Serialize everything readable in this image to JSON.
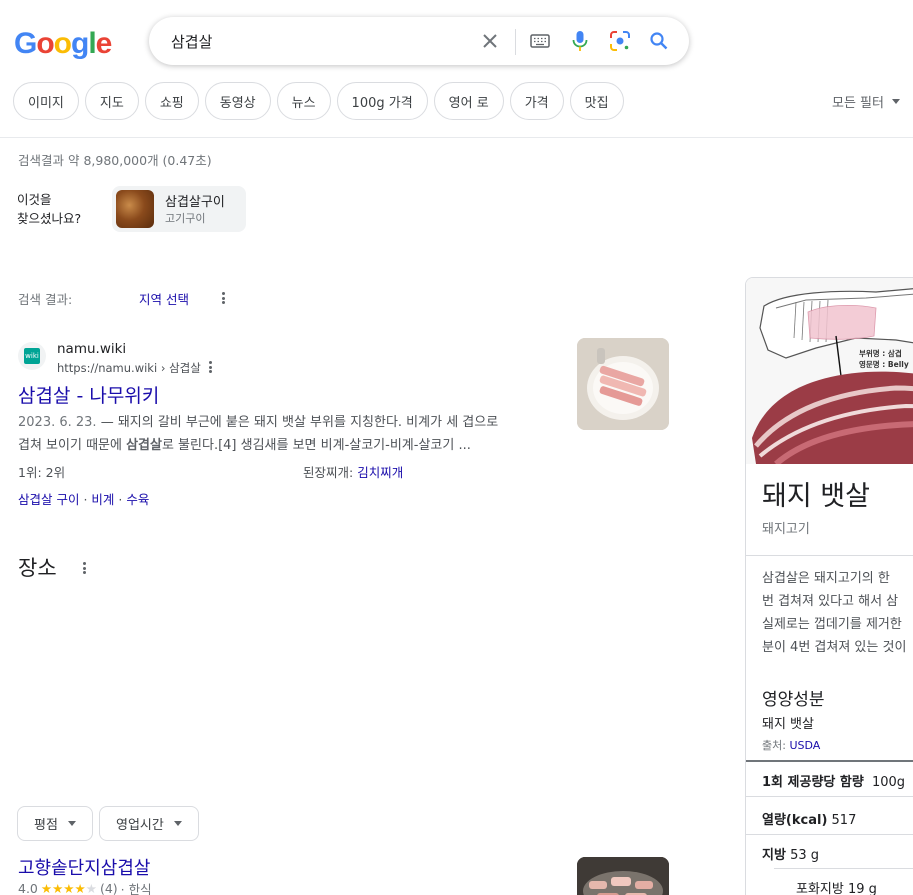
{
  "search": {
    "query": "삼겹살",
    "logo": [
      "G",
      "o",
      "o",
      "g",
      "l",
      "e"
    ],
    "logo_colors": [
      "#4285f4",
      "#ea4335",
      "#fbbc05",
      "#4285f4",
      "#34a853",
      "#ea4335"
    ]
  },
  "chips": [
    "이미지",
    "지도",
    "쇼핑",
    "동영상",
    "뉴스",
    "100g 가격",
    "영어 로",
    "가격",
    "맛집"
  ],
  "all_filters_label": "모든 필터",
  "stats": "검색결과 약 8,980,000개 (0.47초)",
  "did_you_mean": {
    "label_line1": "이것을",
    "label_line2": "찾으셨나요?",
    "title": "삼겹살구이",
    "subtitle": "고기구이"
  },
  "results_header": {
    "label": "검색 결과:",
    "region_link": "지역 선택"
  },
  "result": {
    "site_name": "namu.wiki",
    "url": "https://namu.wiki › 삼겹살",
    "title": "삼겹살 - 나무위키",
    "date": "2023. 6. 23.",
    "snippet_line1": " — 돼지의 갈비 부근에 붙은 돼지 뱃살 부위를 지칭한다. 비계가 세 겹으로",
    "snippet_line2_a": "겹쳐 보이기 때문에 ",
    "snippet_bold": "삼겹살",
    "snippet_line2_b": "로 불린다.[4] 생김새를 보면 비계-살코기-비계-살코기 ...",
    "sub_left": "1위: 2위",
    "sub_right_label": "된장찌개: ",
    "sub_right_link": "김치찌개",
    "sitelinks": [
      "삼겹살 구이",
      "비계",
      "수육"
    ],
    "sitelink_separator": " · "
  },
  "places": {
    "heading": "장소",
    "filters": [
      "평점",
      "영업시간"
    ],
    "first": {
      "name": "고향솥단지삼겹살",
      "rating": "4.0",
      "stars": 4,
      "reviews": "(4)",
      "category": "· 한식"
    }
  },
  "knowledge_panel": {
    "image_label_1": "부위명 : 삼겹",
    "image_label_2": "영문명 : Belly",
    "title": "돼지 뱃살",
    "subtitle": "돼지고기",
    "desc_lines": [
      "삼겹살은 돼지고기의 한",
      "번 겹쳐져 있다고 해서 삼",
      "실제로는 껍데기를 제거한",
      "분이 4번 겹쳐져 있는 것이"
    ],
    "nutrition_heading": "영양성분",
    "nutrition_sub": "돼지 뱃살",
    "source_label": "출처: ",
    "source_link": "USDA",
    "serving_label": "1회 제공량당 함량",
    "serving_value": "100g",
    "calories_label": "열량(kcal)",
    "calories_value": "517",
    "fat_label": "지방",
    "fat_value": "53 g",
    "sat_fat_label": "포화지방",
    "sat_fat_value": "19 g"
  }
}
